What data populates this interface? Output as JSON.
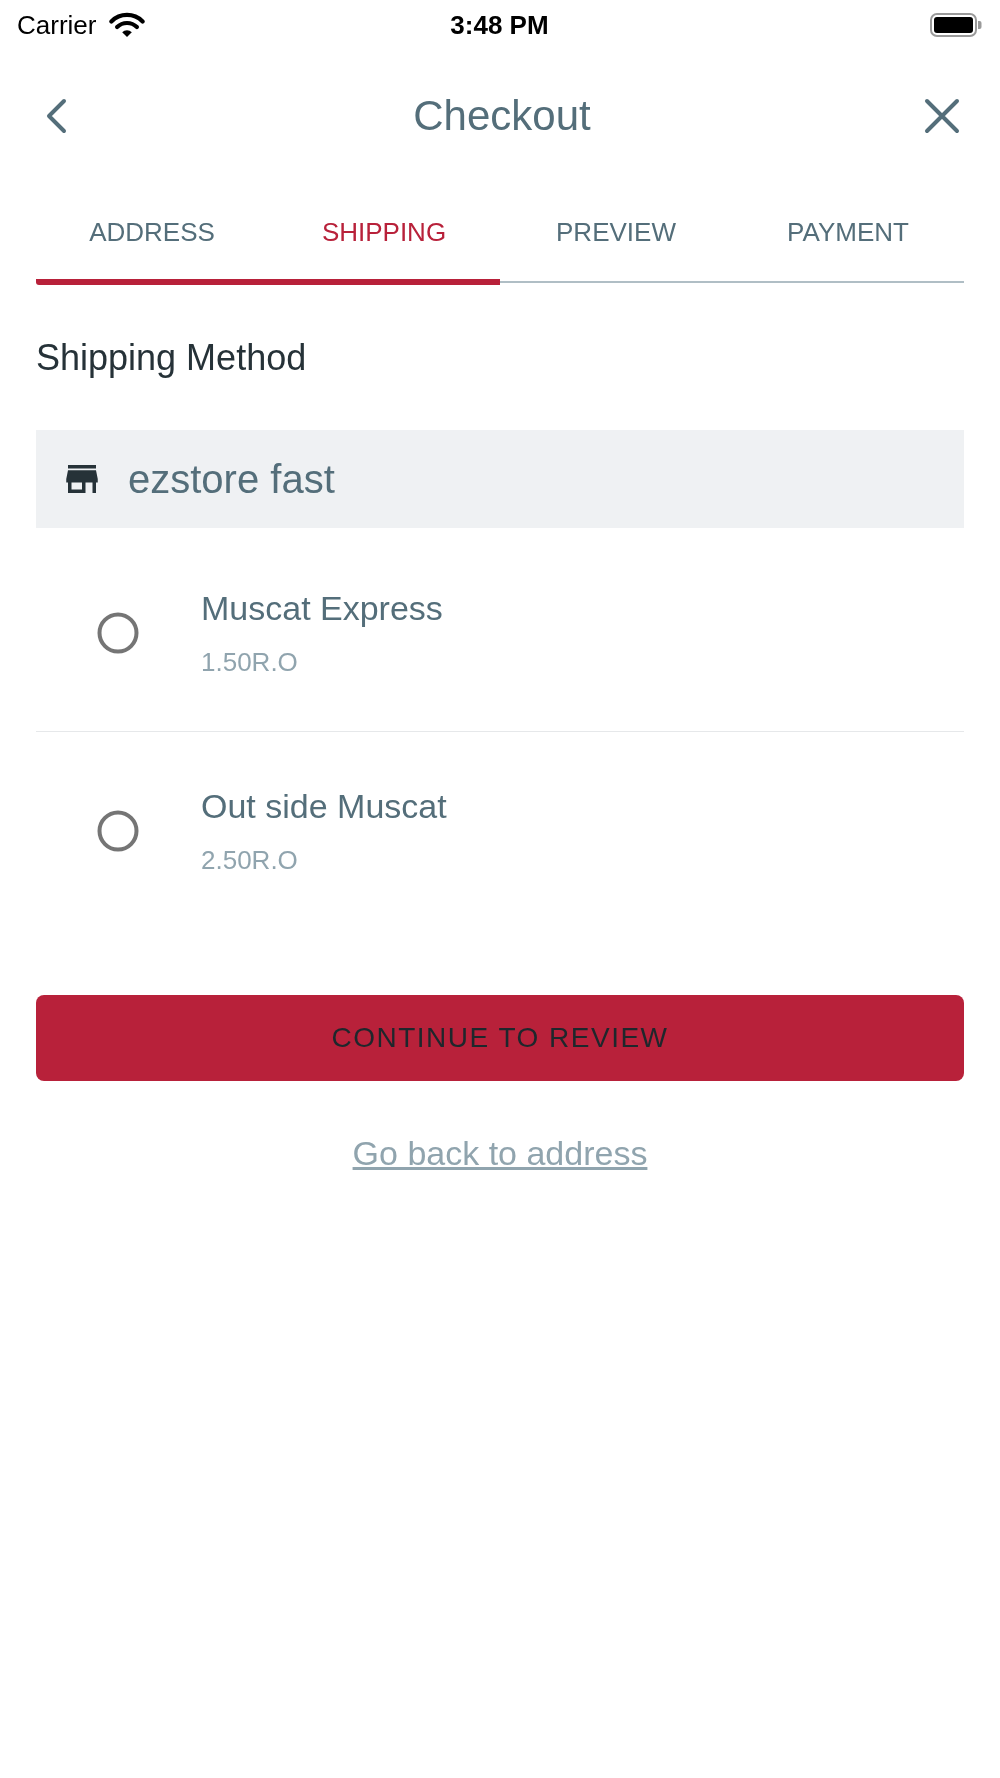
{
  "status_bar": {
    "carrier": "Carrier",
    "time": "3:48 PM"
  },
  "header": {
    "title": "Checkout"
  },
  "tabs": [
    {
      "label": "ADDRESS",
      "selected": false
    },
    {
      "label": "SHIPPING",
      "selected": true
    },
    {
      "label": "PREVIEW",
      "selected": false
    },
    {
      "label": "PAYMENT",
      "selected": false
    }
  ],
  "section_title": "Shipping Method",
  "store": {
    "name": "ezstore fast"
  },
  "shipping_options": [
    {
      "name": "Muscat Express",
      "price": "1.50R.O",
      "selected": false
    },
    {
      "name": "Out side Muscat",
      "price": "2.50R.O",
      "selected": false
    }
  ],
  "continue_button": {
    "label": "CONTINUE TO REVIEW"
  },
  "back_link": {
    "label": "Go back to address"
  }
}
